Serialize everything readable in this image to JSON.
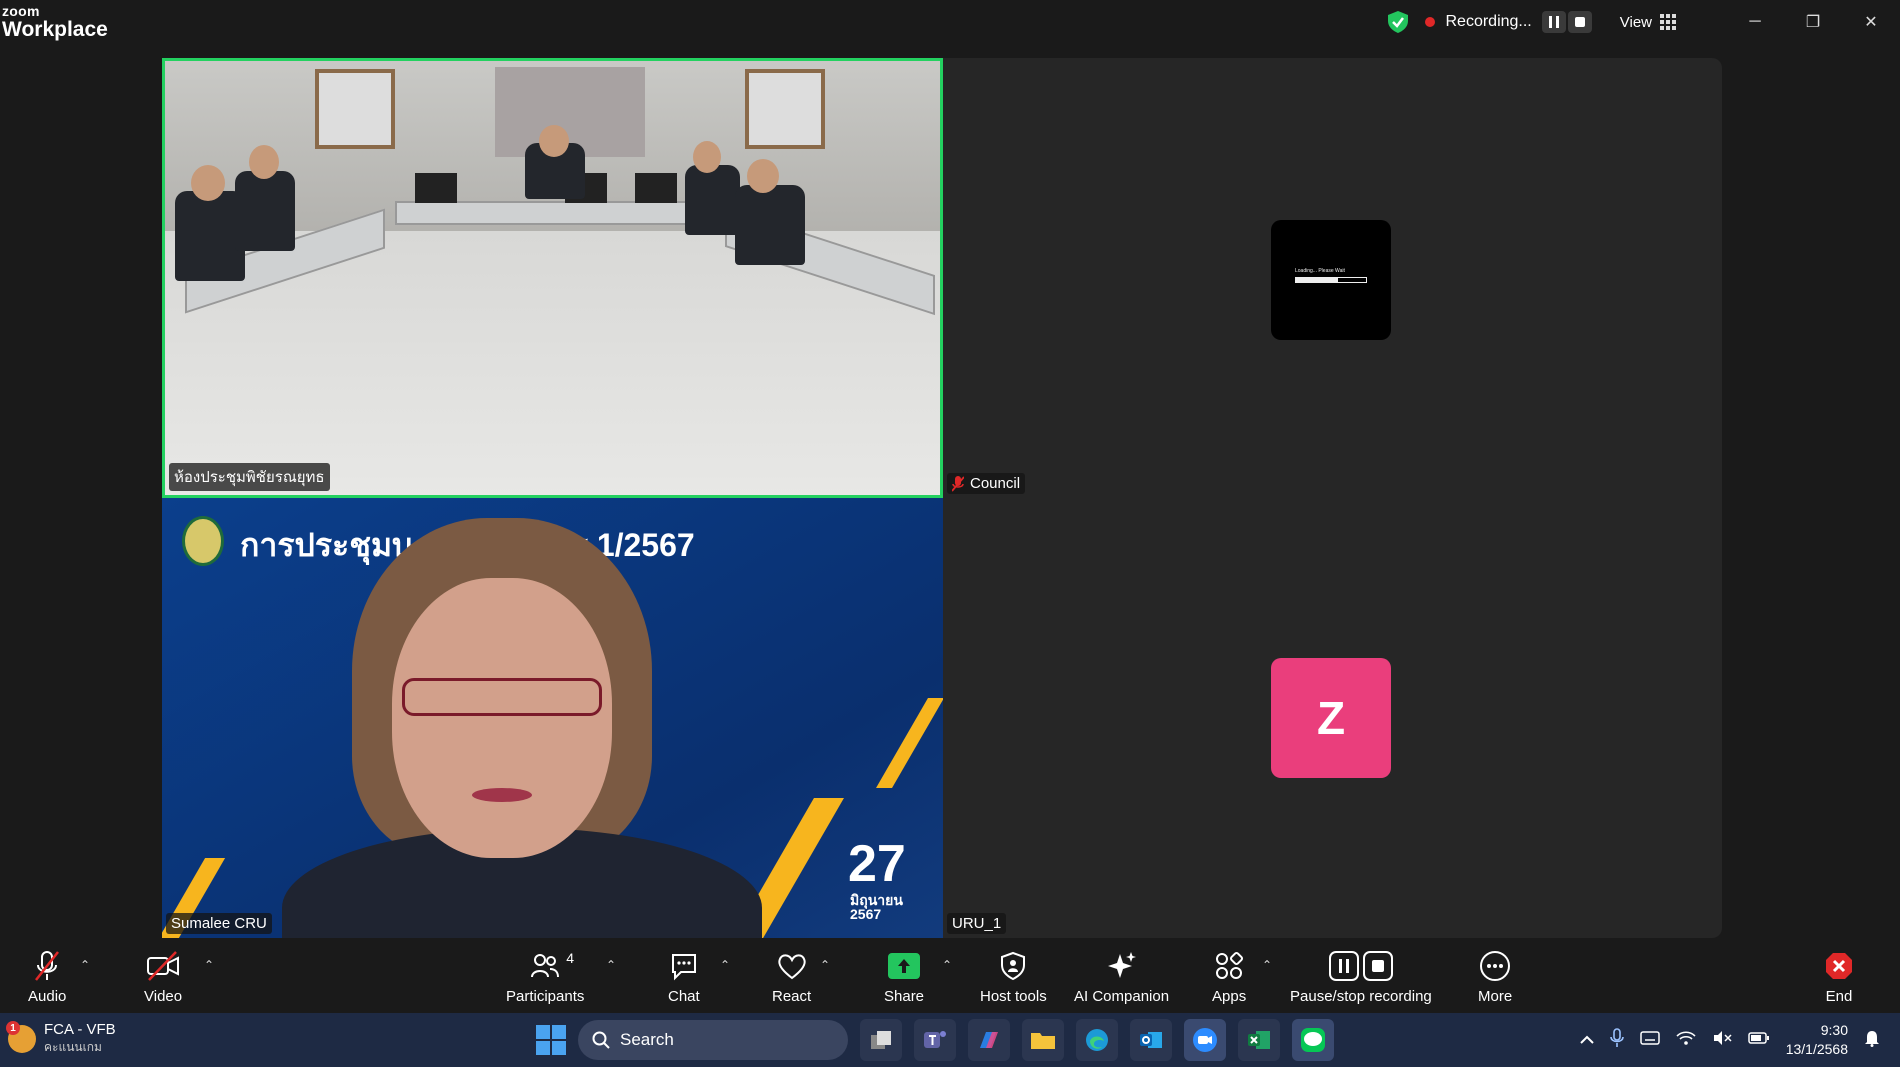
{
  "app": {
    "brand_small": "zoom",
    "brand_large": "Workplace"
  },
  "titlebar": {
    "recording_label": "Recording...",
    "view_label": "View",
    "minimize": "─",
    "restore": "❐",
    "close": "✕"
  },
  "tiles": [
    {
      "name": "ห้องประชุมพิชัยรณยุทธ"
    },
    {
      "name": "Council",
      "loading_text": "Loading... Please Wait"
    },
    {
      "name": "Sumalee CRU",
      "slide_title": "การประชุมบ...ายวิชาการ 1/2567",
      "slide_day": "27",
      "slide_month": "มิถุนายน",
      "slide_year": "2567"
    },
    {
      "name": "URU_1",
      "avatar_letter": "Z"
    }
  ],
  "toolbar": {
    "audio": "Audio",
    "video": "Video",
    "participants": "Participants",
    "participants_count": "4",
    "chat": "Chat",
    "react": "React",
    "share": "Share",
    "host_tools": "Host tools",
    "ai_companion": "AI Companion",
    "apps": "Apps",
    "pause_stop": "Pause/stop recording",
    "more": "More",
    "end": "End",
    "caret": "⌃"
  },
  "taskbar": {
    "notif_count": "1",
    "weather_line1": "FCA - VFB",
    "weather_line2": "คะแนนเกม",
    "search": "Search",
    "time": "9:30",
    "date": "13/1/2568"
  },
  "colors": {
    "active_speaker": "#23d160",
    "recording": "#e02828",
    "share": "#23c55e",
    "end": "#e02828",
    "avatar": "#ea3e7c"
  }
}
